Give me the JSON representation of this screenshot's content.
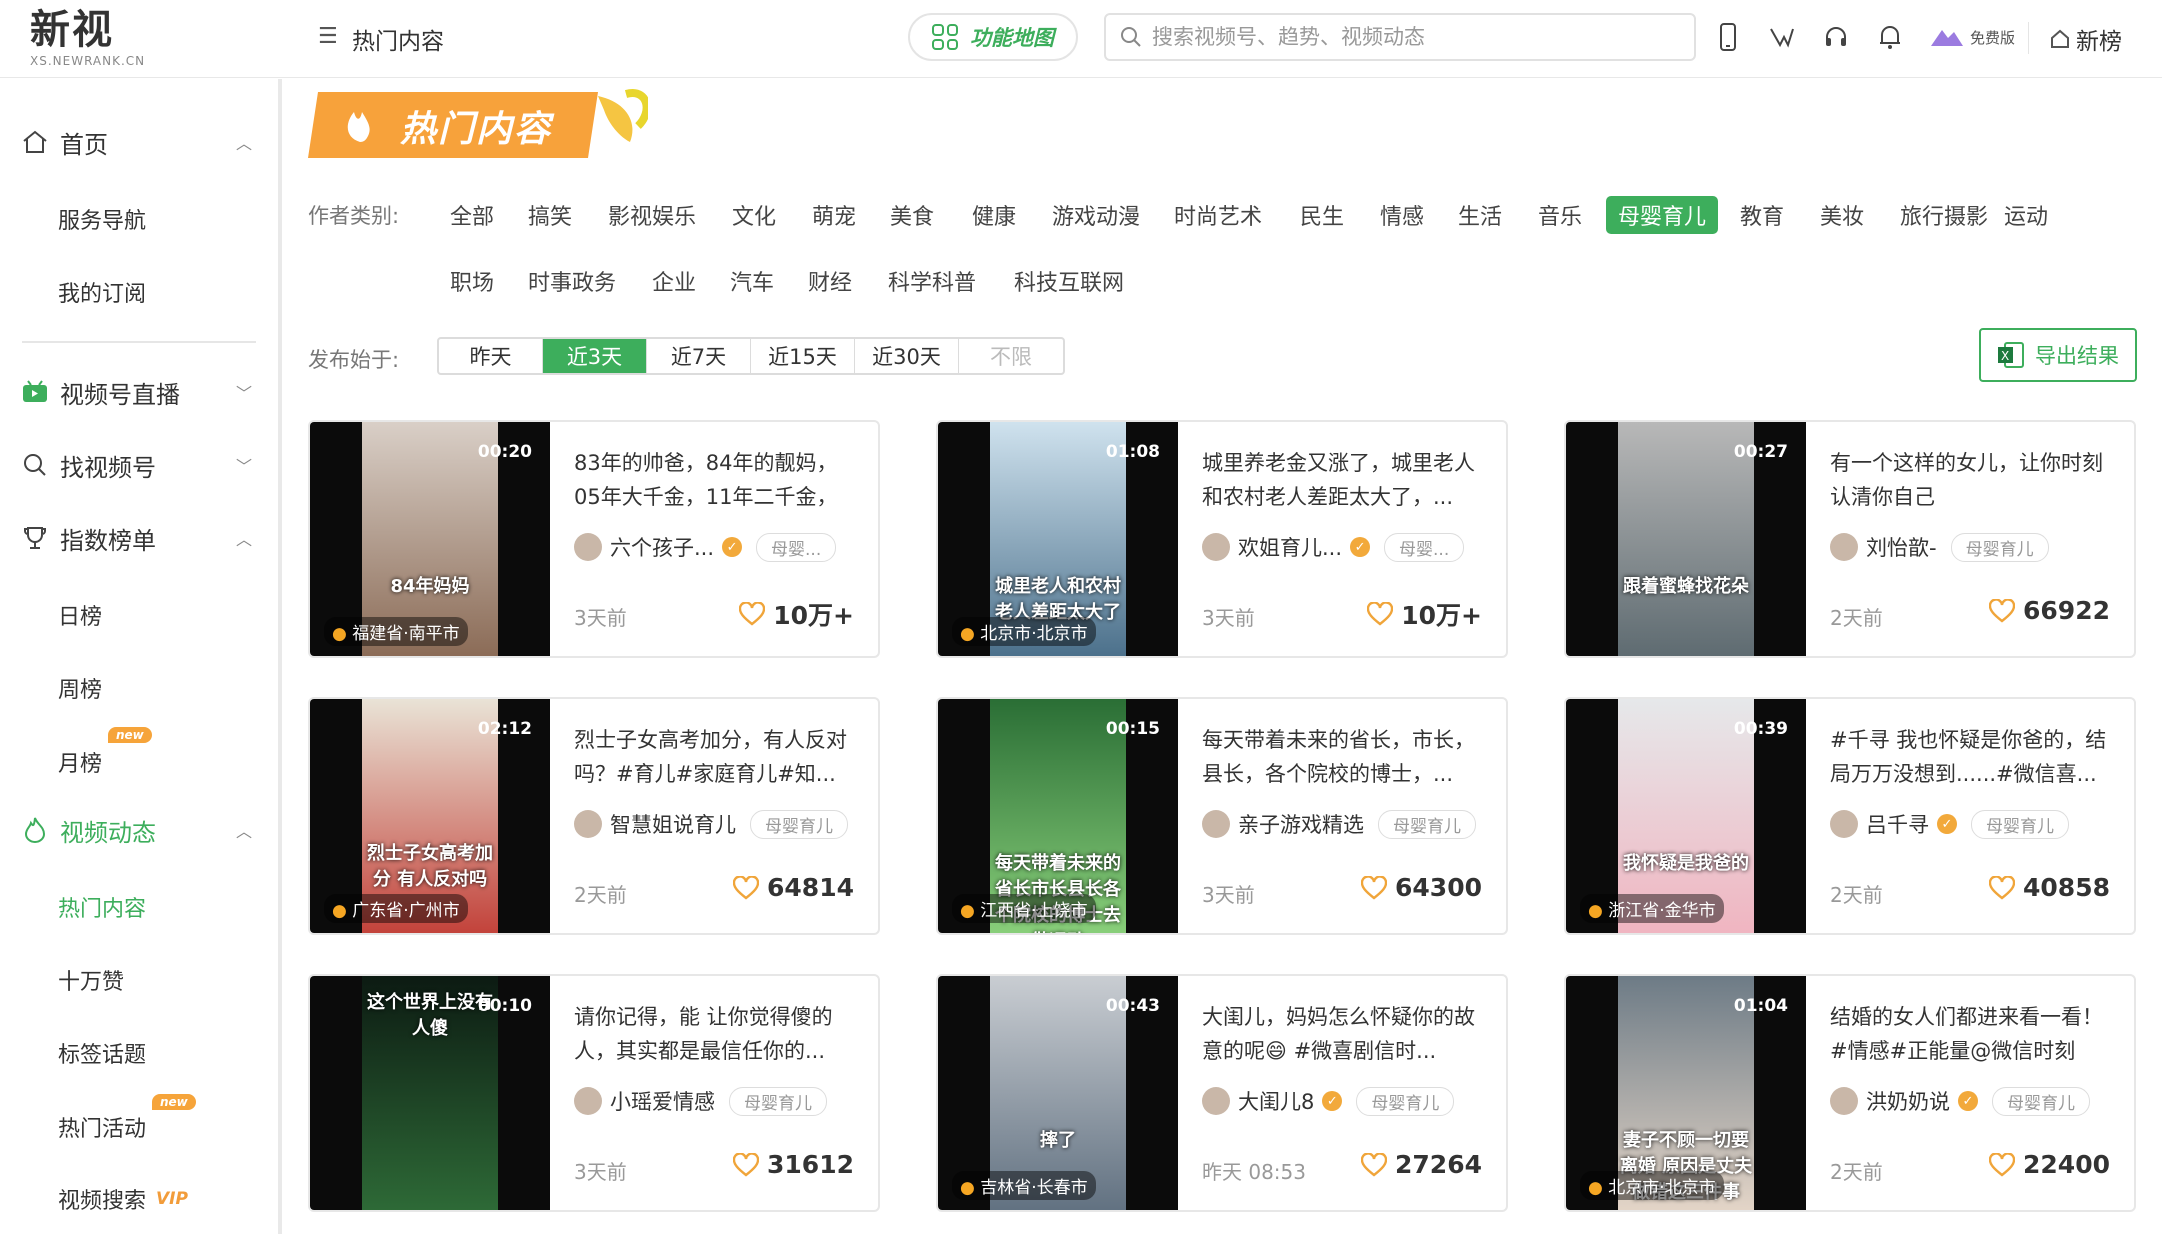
{
  "header": {
    "logo_main": "新视",
    "logo_sub": "XS.NEWRANK.CN",
    "breadcrumb": "热门内容",
    "function_map": "功能地图",
    "search_placeholder": "搜索视频号、趋势、视频动态",
    "plan": "免费版",
    "newrank": "新榜"
  },
  "sidebar": {
    "home": "首页",
    "service_nav": "服务导航",
    "my_subscriptions": "我的订阅",
    "live": "视频号直播",
    "find_channel": "找视频号",
    "rankings": "指数榜单",
    "daily": "日榜",
    "weekly": "周榜",
    "monthly": "月榜",
    "video_dynamics": "视频动态",
    "hot_content": "热门内容",
    "hundred_k": "十万赞",
    "tag_topics": "标签话题",
    "hot_events": "热门活动",
    "video_search": "视频搜索",
    "new_label": "new",
    "vip_label": "VIP"
  },
  "banner": "热门内容",
  "filters": {
    "category_label": "作者类别:",
    "categories_row1": [
      "全部",
      "搞笑",
      "影视娱乐",
      "文化",
      "萌宠",
      "美食",
      "健康",
      "游戏动漫",
      "时尚艺术",
      "民生",
      "情感",
      "生活",
      "音乐",
      "母婴育儿",
      "教育",
      "美妆",
      "旅行摄影",
      "运动"
    ],
    "categories_row2": [
      "职场",
      "时事政务",
      "企业",
      "汽车",
      "财经",
      "科学科普",
      "科技互联网"
    ],
    "active_category": "母婴育儿",
    "published_label": "发布始于:",
    "ranges": [
      "昨天",
      "近3天",
      "近7天",
      "近15天",
      "近30天",
      "不限"
    ],
    "active_range": "近3天",
    "export": "导出结果"
  },
  "cards": [
    {
      "duration": "00:20",
      "location": "福建省·南平市",
      "title": "83年的帅爸，84年的靓妈，05年大千金，11年二千金，1...",
      "author": "六个孩子...",
      "verified": true,
      "tag": "母婴...",
      "time": "3天前",
      "likes": "10万+",
      "caption": "84年妈妈"
    },
    {
      "duration": "01:08",
      "location": "北京市·北京市",
      "title": "城里养老金又涨了，城里老人和农村老人差距太大了，...",
      "author": "欢姐育儿...",
      "verified": true,
      "tag": "母婴...",
      "time": "3天前",
      "likes": "10万+",
      "caption": "城里老人和农村老人差距太大了"
    },
    {
      "duration": "00:27",
      "location": "",
      "title": "有一个这样的女儿，让你时刻认清你自己",
      "author": "刘怡歆-",
      "verified": false,
      "tag": "母婴育儿",
      "time": "2天前",
      "likes": "66922",
      "caption": "跟着蜜蜂找花朵"
    },
    {
      "duration": "02:12",
      "location": "广东省·广州市",
      "title": "烈士子女高考加分，有人反对吗？#育儿#家庭育儿#知...",
      "author": "智慧姐说育儿",
      "verified": false,
      "tag": "母婴育儿",
      "time": "2天前",
      "likes": "64814",
      "caption": "烈士子女高考加分 有人反对吗"
    },
    {
      "duration": "00:15",
      "location": "江西省·上饶市",
      "title": "每天带着未来的省长，市长，县长，各个院校的博士，...",
      "author": "亲子游戏精选",
      "verified": false,
      "tag": "母婴育儿",
      "time": "3天前",
      "likes": "64300",
      "caption": "每天带着未来的省长市长县长各个院校的博士去做运动"
    },
    {
      "duration": "00:39",
      "location": "浙江省·金华市",
      "title": "#千寻 我也怀疑是你爸的，结局万万没想到......#微信喜...",
      "author": "吕千寻",
      "verified": true,
      "tag": "母婴育儿",
      "time": "2天前",
      "likes": "40858",
      "caption": "我怀疑是我爸的"
    },
    {
      "duration": "00:10",
      "location": "",
      "title": "请你记得，能 让你觉得傻的人，其实都是最信任你的...",
      "author": "小瑶爱情感",
      "verified": false,
      "tag": "母婴育儿",
      "time": "3天前",
      "likes": "31612",
      "caption": "这个世界上没有人傻"
    },
    {
      "duration": "00:43",
      "location": "吉林省·长春市",
      "title": "大闺儿，妈妈怎么怀疑你的故意的呢😄 #微喜剧信时...",
      "author": "大闺儿8",
      "verified": true,
      "tag": "母婴育儿",
      "time": "昨天 08:53",
      "likes": "27264",
      "caption": "摔了"
    },
    {
      "duration": "01:04",
      "location": "北京市·北京市",
      "title": "结婚的女人们都进来看一看！#情感#正能量@微信时刻",
      "author": "洪奶奶说",
      "verified": true,
      "tag": "母婴育儿",
      "time": "2天前",
      "likes": "22400",
      "caption": "妻子不顾一切要离婚 原因是丈夫做错这三件事"
    }
  ]
}
